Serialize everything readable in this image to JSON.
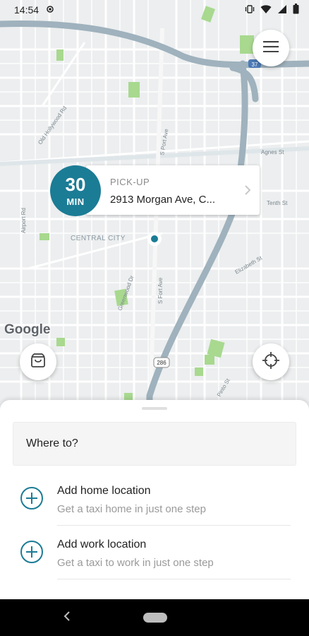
{
  "status_bar": {
    "time": "14:54"
  },
  "map": {
    "labels": {
      "central_city": "CENTRAL CITY",
      "highway_shield": "37",
      "route_shield": "286",
      "street_1": "Agnes St",
      "street_2": "Elizabeth St",
      "street_3": "Greenwood Dr",
      "street_4": "S Fort Ave",
      "street_5": "Old Hollywood Rd",
      "street_6": "Airport Rd",
      "street_7": "S Port Ave",
      "street_8": "Pinto St",
      "street_9": "Tenth St"
    },
    "attribution": "Google"
  },
  "pickup": {
    "eta_value": "30",
    "eta_unit": "MIN",
    "label": "PICK-UP",
    "address": "2913 Morgan Ave, C..."
  },
  "sheet": {
    "search_label": "Where to?",
    "locations": [
      {
        "title": "Add home location",
        "subtitle": "Get a taxi home in just one step"
      },
      {
        "title": "Add work location",
        "subtitle": "Get a taxi to work in just one step"
      }
    ]
  },
  "icons": {
    "menu": "hamburger-menu-icon",
    "shop": "shopping-bag-icon",
    "locate": "crosshair-icon",
    "add": "plus-circle-icon",
    "back": "back-triangle-icon"
  },
  "colors": {
    "accent": "#1b7c95",
    "map_bg": "#eceeef",
    "road_major": "#9fb2bd",
    "park": "#a8d98f"
  }
}
